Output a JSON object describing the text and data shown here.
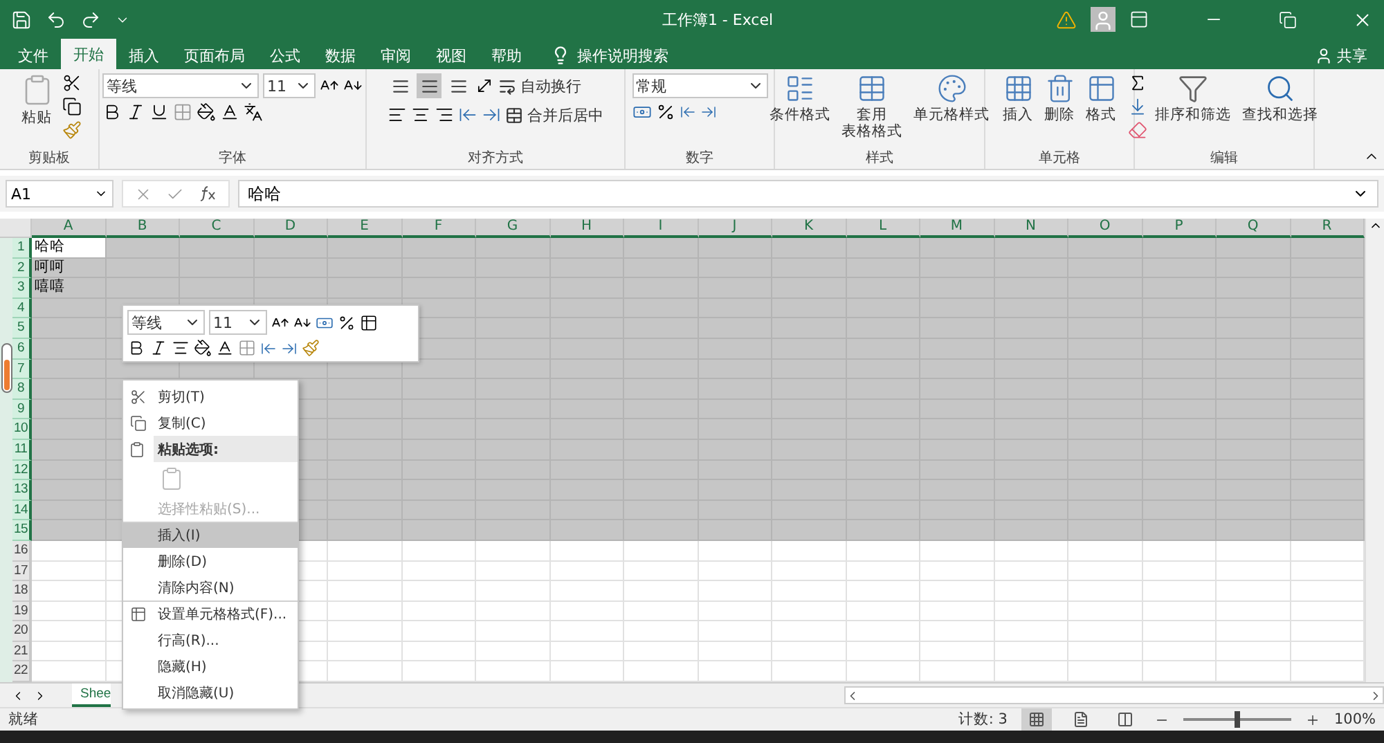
{
  "window": {
    "title": "工作簿1  -  Excel"
  },
  "tabs": [
    {
      "label": "文件",
      "selected": false
    },
    {
      "label": "开始",
      "selected": true
    },
    {
      "label": "插入",
      "selected": false
    },
    {
      "label": "页面布局",
      "selected": false
    },
    {
      "label": "公式",
      "selected": false
    },
    {
      "label": "数据",
      "selected": false
    },
    {
      "label": "审阅",
      "selected": false
    },
    {
      "label": "视图",
      "selected": false
    },
    {
      "label": "帮助",
      "selected": false
    }
  ],
  "search": {
    "placeholder": "操作说明搜索"
  },
  "share": "共享",
  "ribbon": {
    "clipboard": {
      "paste": "粘贴",
      "label": "剪贴板"
    },
    "font": {
      "name": "等线",
      "size": "11",
      "label": "字体"
    },
    "alignment": {
      "vertical": [
        {
          "selected": false
        },
        {
          "selected": true
        },
        {
          "selected": false
        }
      ],
      "wrap": "自动换行",
      "merge": "合并后居中",
      "label": "对齐方式"
    },
    "number": {
      "format": "常规",
      "label": "数字"
    },
    "styles": {
      "buttons": [
        {
          "lines": [
            "条件格式"
          ]
        },
        {
          "lines": [
            "套用",
            "表格格式"
          ]
        },
        {
          "lines": [
            "单元格样式"
          ]
        }
      ],
      "label": "样式"
    },
    "cells": {
      "buttons": [
        "插入",
        "删除",
        "格式"
      ],
      "label": "单元格"
    },
    "editing": {
      "buttons": [
        "排序和筛选",
        "查找和选择"
      ],
      "label": "编辑"
    }
  },
  "formula_bar": {
    "name_box": "A1",
    "value": "哈哈"
  },
  "columns": [
    {
      "label": "A",
      "selected": true
    },
    {
      "label": "B",
      "selected": true
    },
    {
      "label": "C",
      "selected": true
    },
    {
      "label": "D",
      "selected": true
    },
    {
      "label": "E",
      "selected": true
    },
    {
      "label": "F",
      "selected": true
    },
    {
      "label": "G",
      "selected": true
    },
    {
      "label": "H",
      "selected": true
    },
    {
      "label": "I",
      "selected": true
    },
    {
      "label": "J",
      "selected": true
    },
    {
      "label": "K",
      "selected": true
    },
    {
      "label": "L",
      "selected": true
    },
    {
      "label": "M",
      "selected": true
    },
    {
      "label": "N",
      "selected": true
    },
    {
      "label": "O",
      "selected": true
    },
    {
      "label": "P",
      "selected": true
    },
    {
      "label": "Q",
      "selected": true
    },
    {
      "label": "R",
      "selected": true
    }
  ],
  "rows": [
    {
      "label": "1",
      "selected": true,
      "active": true,
      "cells": [
        "哈哈"
      ]
    },
    {
      "label": "2",
      "selected": true,
      "active": false,
      "cells": [
        "呵呵"
      ]
    },
    {
      "label": "3",
      "selected": true,
      "active": false,
      "cells": [
        "嘻嘻"
      ]
    },
    {
      "label": "4",
      "selected": true,
      "active": false,
      "cells": []
    },
    {
      "label": "5",
      "selected": true,
      "active": false,
      "cells": []
    },
    {
      "label": "6",
      "selected": true,
      "active": false,
      "cells": []
    },
    {
      "label": "7",
      "selected": true,
      "active": false,
      "cells": []
    },
    {
      "label": "8",
      "selected": true,
      "active": false,
      "cells": []
    },
    {
      "label": "9",
      "selected": true,
      "active": false,
      "cells": []
    },
    {
      "label": "10",
      "selected": true,
      "active": false,
      "cells": []
    },
    {
      "label": "11",
      "selected": true,
      "active": false,
      "cells": []
    },
    {
      "label": "12",
      "selected": true,
      "active": false,
      "cells": []
    },
    {
      "label": "13",
      "selected": true,
      "active": false,
      "cells": []
    },
    {
      "label": "14",
      "selected": true,
      "active": false,
      "cells": []
    },
    {
      "label": "15",
      "selected": true,
      "active": false,
      "cells": []
    },
    {
      "label": "16",
      "selected": false,
      "active": false,
      "cells": []
    },
    {
      "label": "17",
      "selected": false,
      "active": false,
      "cells": []
    },
    {
      "label": "18",
      "selected": false,
      "active": false,
      "cells": []
    },
    {
      "label": "19",
      "selected": false,
      "active": false,
      "cells": []
    },
    {
      "label": "20",
      "selected": false,
      "active": false,
      "cells": []
    },
    {
      "label": "21",
      "selected": false,
      "active": false,
      "cells": []
    },
    {
      "label": "22",
      "selected": false,
      "active": false,
      "cells": []
    }
  ],
  "mini_toolbar": {
    "font": "等线",
    "size": "11"
  },
  "context_menu": [
    {
      "kind": "cut",
      "label": "剪切(T)",
      "selected": false,
      "disabled": false
    },
    {
      "kind": "copy",
      "label": "复制(C)",
      "selected": false,
      "disabled": false
    },
    {
      "kind": "paste-header",
      "label": "粘贴选项:",
      "selected": false,
      "disabled": false
    },
    {
      "kind": "paste-option",
      "selected": false,
      "disabled": true
    },
    {
      "kind": "item",
      "label": "选择性粘贴(S)...",
      "selected": false,
      "disabled": true
    },
    {
      "kind": "item",
      "label": "插入(I)",
      "selected": true,
      "disabled": false,
      "separator": true
    },
    {
      "kind": "item",
      "label": "删除(D)",
      "selected": false,
      "disabled": false
    },
    {
      "kind": "item",
      "label": "清除内容(N)",
      "selected": false,
      "disabled": false
    },
    {
      "kind": "format",
      "label": "设置单元格格式(F)...",
      "selected": false,
      "disabled": false,
      "separator": true
    },
    {
      "kind": "item",
      "label": "行高(R)...",
      "selected": false,
      "disabled": false
    },
    {
      "kind": "item",
      "label": "隐藏(H)",
      "selected": false,
      "disabled": false
    },
    {
      "kind": "item",
      "label": "取消隐藏(U)",
      "selected": false,
      "disabled": false
    }
  ],
  "sheet_tabs": [
    {
      "label": "Shee",
      "selected": true
    }
  ],
  "status_bar": {
    "text": "就绪",
    "count": "计数: 3",
    "views": [
      {
        "selected": true
      },
      {
        "selected": false
      },
      {
        "selected": false
      }
    ],
    "zoom": {
      "level": 0.5,
      "reading": "100%"
    }
  }
}
